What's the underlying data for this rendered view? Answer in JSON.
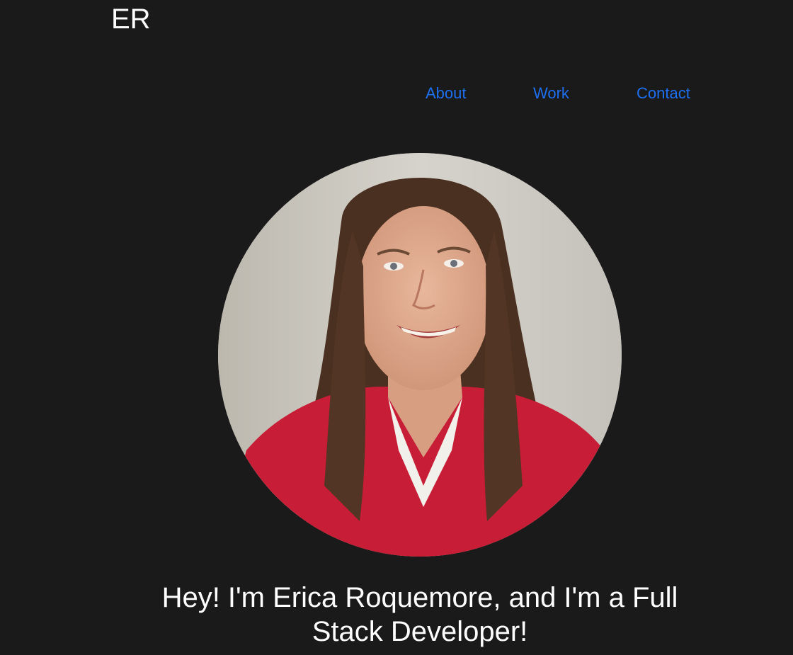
{
  "header": {
    "logo_text": "ER"
  },
  "nav": {
    "items": [
      {
        "label": "About"
      },
      {
        "label": "Work"
      },
      {
        "label": "Contact"
      }
    ],
    "link_color": "#1e6ff0"
  },
  "hero": {
    "headline_line1": "Hey! I'm Erica Roquemore, and I'm a Full",
    "headline_line2": "Stack Developer!"
  },
  "colors": {
    "background": "#1a1a1a",
    "text": "#ffffff"
  }
}
